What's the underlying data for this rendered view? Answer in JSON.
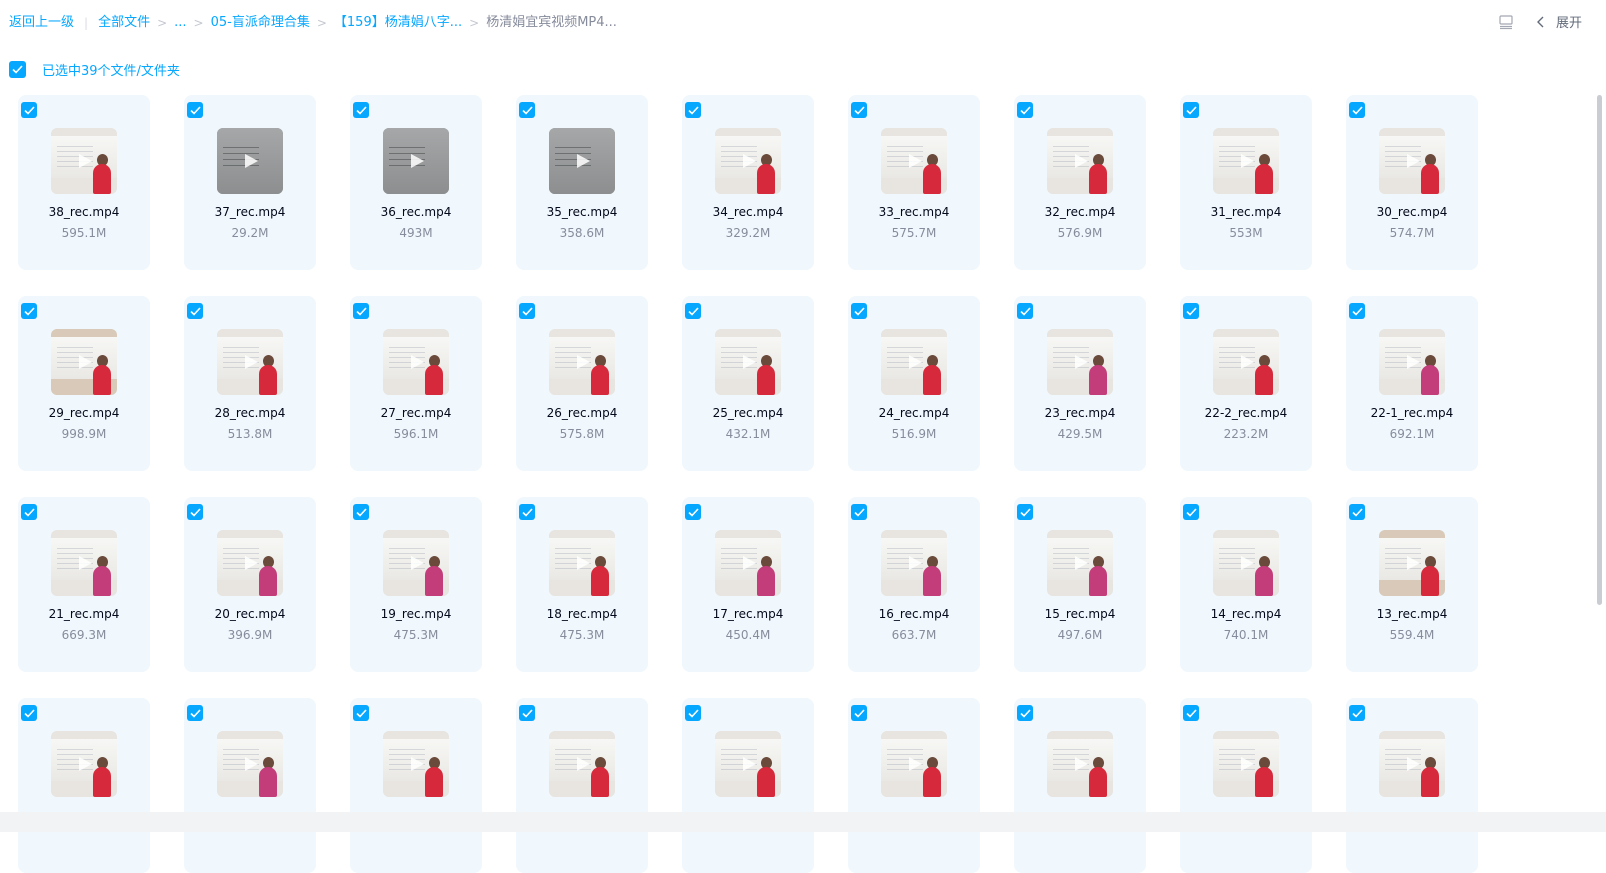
{
  "breadcrumb": {
    "back": "返回上一级",
    "all_files": "全部文件",
    "ellipsis": "...",
    "level1": "05-盲派命理合集",
    "level2": "【159】杨清娟八字...",
    "current": "杨清娟宜宾视频MP4..."
  },
  "toolbar": {
    "expand_label": "展开",
    "view_icon": "list-view-icon",
    "chevron_icon": "chevron-left-icon"
  },
  "selection": {
    "label": "已选中39个文件/文件夹",
    "checked": true
  },
  "colors": {
    "accent": "#06a7ff",
    "card_bg": "#f0f8fd",
    "name_text": "#03081a",
    "size_text": "#878c9c"
  },
  "files": [
    {
      "name": "38_rec.mp4",
      "size": "595.1M"
    },
    {
      "name": "37_rec.mp4",
      "size": "29.2M"
    },
    {
      "name": "36_rec.mp4",
      "size": "493M"
    },
    {
      "name": "35_rec.mp4",
      "size": "358.6M"
    },
    {
      "name": "34_rec.mp4",
      "size": "329.2M"
    },
    {
      "name": "33_rec.mp4",
      "size": "575.7M"
    },
    {
      "name": "32_rec.mp4",
      "size": "576.9M"
    },
    {
      "name": "31_rec.mp4",
      "size": "553M"
    },
    {
      "name": "30_rec.mp4",
      "size": "574.7M"
    },
    {
      "name": "29_rec.mp4",
      "size": "998.9M"
    },
    {
      "name": "28_rec.mp4",
      "size": "513.8M"
    },
    {
      "name": "27_rec.mp4",
      "size": "596.1M"
    },
    {
      "name": "26_rec.mp4",
      "size": "575.8M"
    },
    {
      "name": "25_rec.mp4",
      "size": "432.1M"
    },
    {
      "name": "24_rec.mp4",
      "size": "516.9M"
    },
    {
      "name": "23_rec.mp4",
      "size": "429.5M"
    },
    {
      "name": "22-2_rec.mp4",
      "size": "223.2M"
    },
    {
      "name": "22-1_rec.mp4",
      "size": "692.1M"
    },
    {
      "name": "21_rec.mp4",
      "size": "669.3M"
    },
    {
      "name": "20_rec.mp4",
      "size": "396.9M"
    },
    {
      "name": "19_rec.mp4",
      "size": "475.3M"
    },
    {
      "name": "18_rec.mp4",
      "size": "475.3M"
    },
    {
      "name": "17_rec.mp4",
      "size": "450.4M"
    },
    {
      "name": "16_rec.mp4",
      "size": "663.7M"
    },
    {
      "name": "15_rec.mp4",
      "size": "497.6M"
    },
    {
      "name": "14_rec.mp4",
      "size": "740.1M"
    },
    {
      "name": "13_rec.mp4",
      "size": "559.4M"
    },
    {
      "name": "",
      "size": ""
    },
    {
      "name": "",
      "size": ""
    },
    {
      "name": "",
      "size": ""
    },
    {
      "name": "",
      "size": ""
    },
    {
      "name": "",
      "size": ""
    },
    {
      "name": "",
      "size": ""
    },
    {
      "name": "",
      "size": ""
    },
    {
      "name": "",
      "size": ""
    },
    {
      "name": "",
      "size": ""
    }
  ]
}
